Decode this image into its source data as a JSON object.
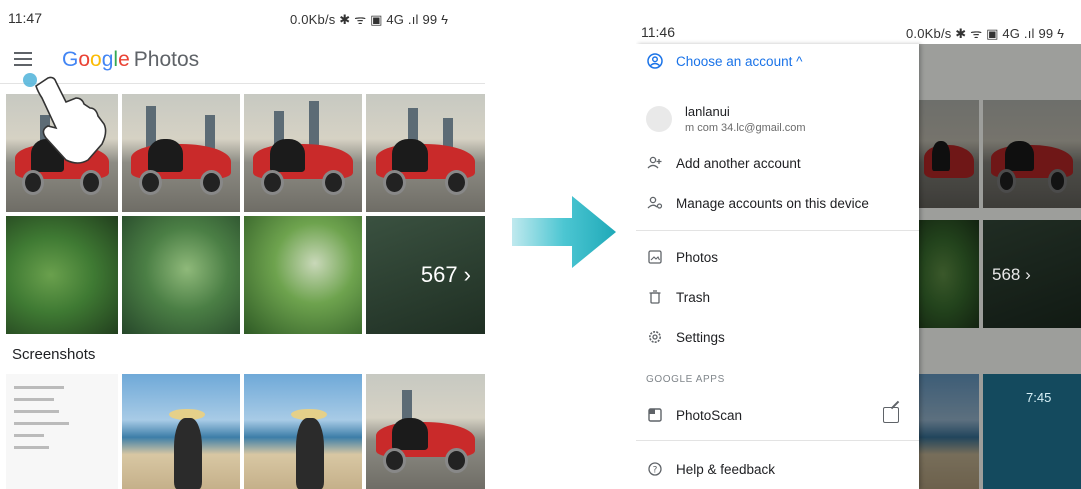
{
  "left_phone": {
    "status": {
      "time": "11:47",
      "right": "0.0Kb/s ✱ ᯤ ▣ 4G .ıl 99 ϟ"
    },
    "app_title": "Google Photos",
    "logo_letters": [
      "G",
      "o",
      "o",
      "g",
      "l",
      "e"
    ],
    "logo_rest": "Photos",
    "more_count": "567 ›",
    "section_label": "Screenshots"
  },
  "right_phone": {
    "status": {
      "time": "11:46",
      "right": "0.0Kb/s ✱ ᯤ ▣ 4G .ıl 99 ϟ"
    },
    "drawer": {
      "choose_account": "Choose an account ^",
      "account_name": "lanlanui",
      "account_email": "m com 34.lc@gmail.com",
      "add_account": "Add another account",
      "manage_accounts": "Manage accounts on this device",
      "photos": "Photos",
      "trash": "Trash",
      "settings": "Settings",
      "apps_header": "GOOGLE APPS",
      "photoscan": "PhotoScan",
      "help": "Help & feedback"
    },
    "bg_more_count": "568 ›",
    "bg_lock_time": "7:45"
  },
  "colors": {
    "arrow": "#2ab8c7",
    "accent": "#1a73e8"
  }
}
